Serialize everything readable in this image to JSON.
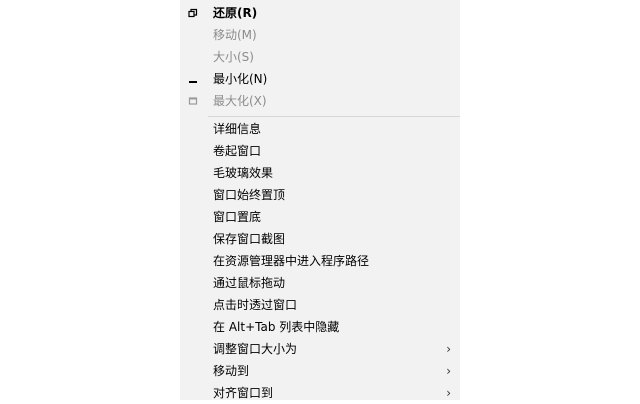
{
  "menu": {
    "system_items": [
      {
        "label": "还原(R)",
        "icon": "restore-icon",
        "enabled": true,
        "bold": true
      },
      {
        "label": "移动(M)",
        "icon": "",
        "enabled": false,
        "bold": false
      },
      {
        "label": "大小(S)",
        "icon": "",
        "enabled": false,
        "bold": false
      },
      {
        "label": "最小化(N)",
        "icon": "minimize-icon",
        "enabled": true,
        "bold": false
      },
      {
        "label": "最大化(X)",
        "icon": "maximize-icon",
        "enabled": false,
        "bold": false
      }
    ],
    "extra_items": [
      {
        "label": "详细信息",
        "submenu": false
      },
      {
        "label": "卷起窗口",
        "submenu": false
      },
      {
        "label": "毛玻璃效果",
        "submenu": false
      },
      {
        "label": "窗口始终置顶",
        "submenu": false
      },
      {
        "label": "窗口置底",
        "submenu": false
      },
      {
        "label": "保存窗口截图",
        "submenu": false
      },
      {
        "label": "在资源管理器中进入程序路径",
        "submenu": false
      },
      {
        "label": "通过鼠标拖动",
        "submenu": false
      },
      {
        "label": "点击时透过窗口",
        "submenu": false
      },
      {
        "label": "在 Alt+Tab 列表中隐藏",
        "submenu": false
      },
      {
        "label": "调整窗口大小为",
        "submenu": true
      },
      {
        "label": "移动到",
        "submenu": true
      },
      {
        "label": "对齐窗口到",
        "submenu": true
      }
    ],
    "submenu_arrow": "›"
  },
  "colors": {
    "menu_bg": "#f2f2f2",
    "text": "#000000",
    "disabled_text": "#8c8c8c",
    "separator": "#d7d7d7"
  }
}
